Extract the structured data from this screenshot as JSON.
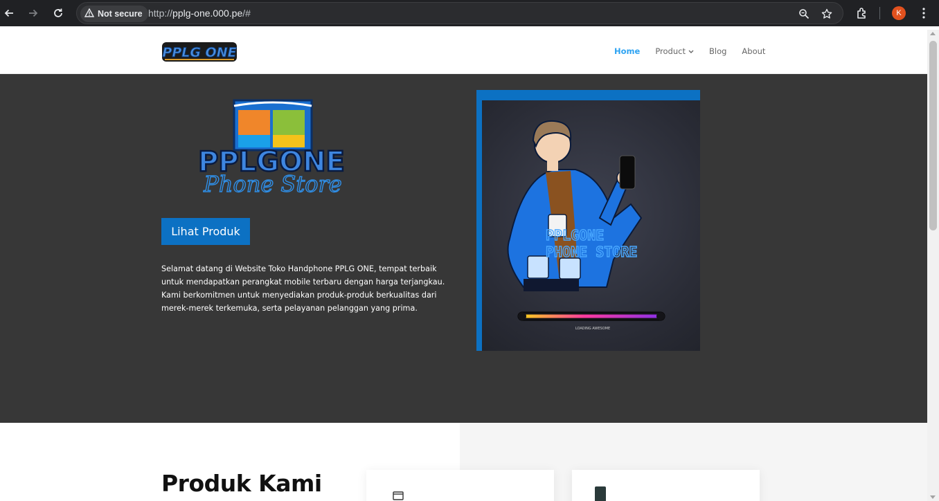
{
  "browser": {
    "security_label": "Not secure",
    "url_scheme": "http://",
    "url_host": "pplg-one.000.pe",
    "url_path": "/#",
    "profile_initial": "K"
  },
  "header": {
    "logo_text": "PPLG ONE",
    "nav": [
      {
        "label": "Home",
        "active": true
      },
      {
        "label": "Product",
        "has_dropdown": true
      },
      {
        "label": "Blog"
      },
      {
        "label": "About"
      }
    ]
  },
  "hero": {
    "logo_line1": "PPLGONE",
    "logo_line2": "Phone Store",
    "cta_label": "Lihat Produk",
    "description": "Selamat datang di Website Toko Handphone PPLG ONE, tempat terbaik untuk mendapatkan perangkat mobile terbaru dengan harga terjangkau. Kami berkomitmen untuk menyediakan produk-produk berkualitas dari merek-merek terkemuka, serta pelayanan pelanggan yang prima.",
    "image_title_line1": "PPLGONE",
    "image_title_line2": "PHONE STORE",
    "image_loading_text": "LOADING AWESOME"
  },
  "products": {
    "title": "Produk Kami"
  },
  "colors": {
    "accent": "#0c71c3",
    "nav_active": "#2ea3f2",
    "hero_bg": "#373737",
    "chrome_bg": "#202124"
  }
}
